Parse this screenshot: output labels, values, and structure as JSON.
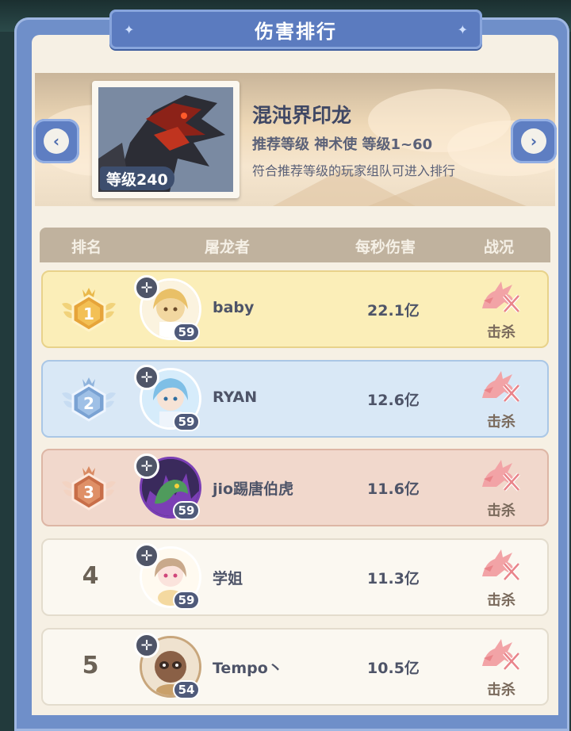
{
  "title": "伤害排行",
  "boss": {
    "name": "混沌界印龙",
    "level_badge": "等级240",
    "recommend": "推荐等级 神术使  等级1~60",
    "note": "符合推荐等级的玩家组队可进入排行"
  },
  "table_header": {
    "rank": "排名",
    "slayer": "屠龙者",
    "dps": "每秒伤害",
    "status": "战况"
  },
  "rows": [
    {
      "rank": "1",
      "name": "baby",
      "level": "59",
      "dps": "22.1亿",
      "status": "击杀"
    },
    {
      "rank": "2",
      "name": "RYAN",
      "level": "59",
      "dps": "12.6亿",
      "status": "击杀"
    },
    {
      "rank": "3",
      "name": "jio踢唐伯虎",
      "level": "59",
      "dps": "11.6亿",
      "status": "击杀"
    },
    {
      "rank": "4",
      "name": "学姐",
      "level": "59",
      "dps": "11.3亿",
      "status": "击杀"
    },
    {
      "rank": "5",
      "name": "Tempo丶",
      "level": "54",
      "dps": "10.5亿",
      "status": "击杀"
    }
  ],
  "colors": {
    "frame": "#6f8fc9",
    "panel": "#f6f0e4",
    "gold_row": "#fbeeb8",
    "silver_row": "#d9e8f6",
    "bronze_row": "#f1d8cc",
    "kill_icon": "#ee8d92"
  },
  "icons": {
    "prev": "chevron-left-icon",
    "next": "chevron-right-icon",
    "medal": "winged-medal-icon",
    "kill": "dragon-kill-icon",
    "emblem": "crosshair-emblem-icon"
  }
}
